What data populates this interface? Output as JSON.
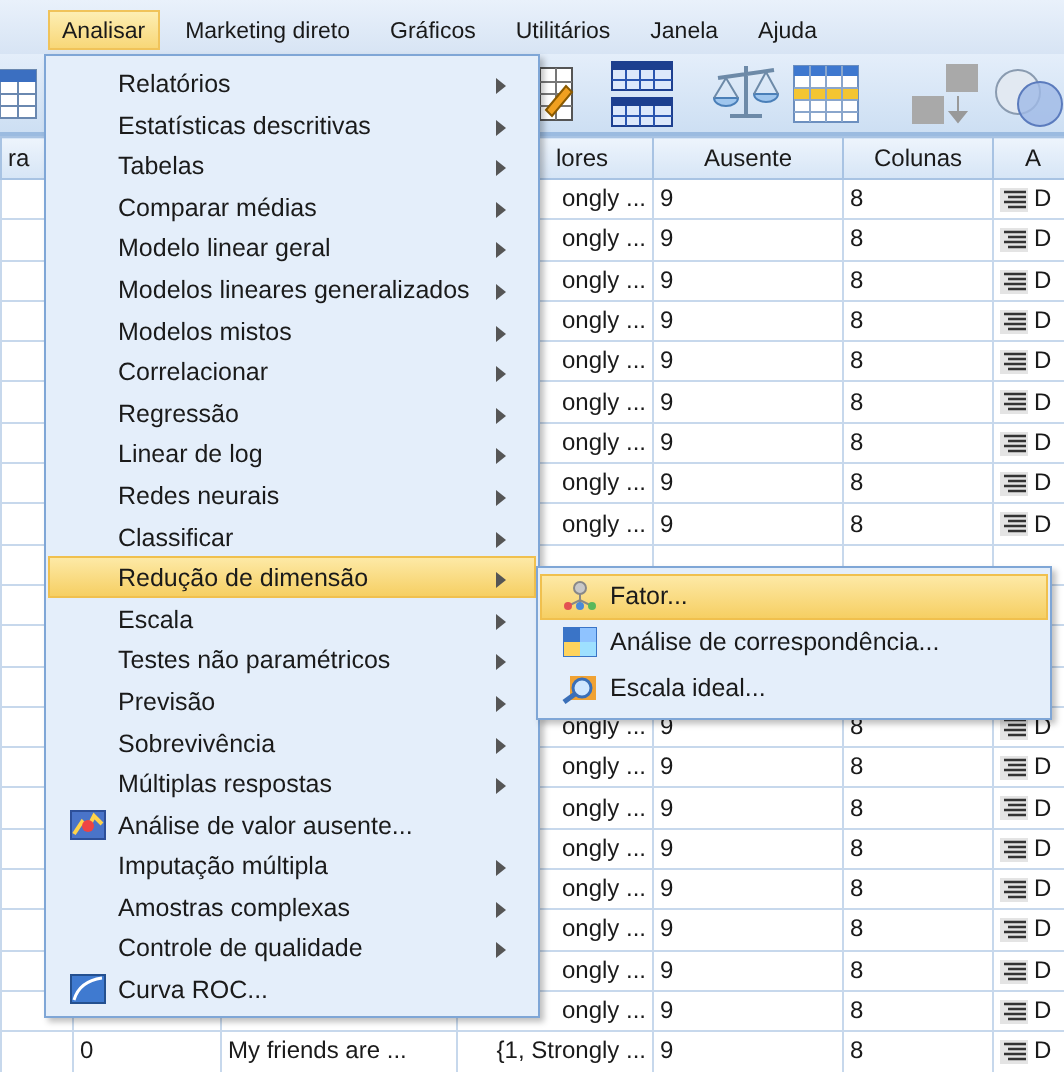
{
  "menu_bar": [
    {
      "label": "Analisar",
      "selected": true
    },
    {
      "label": "Marketing direto",
      "selected": false
    },
    {
      "label": "Gráficos",
      "selected": false
    },
    {
      "label": "Utilitários",
      "selected": false
    },
    {
      "label": "Janela",
      "selected": false
    },
    {
      "label": "Ajuda",
      "selected": false
    }
  ],
  "grid": {
    "columns": [
      {
        "header": "ra"
      },
      {},
      {},
      {
        "header": "lores"
      },
      {
        "header": "Ausente"
      },
      {
        "header": "Colunas"
      },
      {
        "header": "A"
      }
    ],
    "rows": [
      {
        "cells": [
          null,
          null,
          null,
          "ongly ...",
          "9",
          "8",
          "D"
        ]
      },
      {
        "cells": [
          null,
          null,
          null,
          "ongly ...",
          "9",
          "8",
          "D"
        ]
      },
      {
        "cells": [
          null,
          null,
          null,
          "ongly ...",
          "9",
          "8",
          "D"
        ]
      },
      {
        "cells": [
          null,
          null,
          null,
          "ongly ...",
          "9",
          "8",
          "D"
        ]
      },
      {
        "cells": [
          null,
          null,
          null,
          "ongly ...",
          "9",
          "8",
          "D"
        ]
      },
      {
        "cells": [
          null,
          null,
          null,
          "ongly ...",
          "9",
          "8",
          "D"
        ]
      },
      {
        "cells": [
          null,
          null,
          null,
          "ongly ...",
          "9",
          "8",
          "D"
        ]
      },
      {
        "cells": [
          null,
          null,
          null,
          "ongly ...",
          "9",
          "8",
          "D"
        ]
      },
      {
        "cells": [
          null,
          null,
          null,
          "ongly ...",
          "9",
          "8",
          "D"
        ]
      },
      {
        "cells": [
          null,
          null,
          null,
          null,
          null,
          null,
          null
        ]
      },
      {
        "cells": [
          null,
          null,
          null,
          null,
          null,
          null,
          null
        ]
      },
      {
        "cells": [
          null,
          null,
          null,
          null,
          null,
          null,
          null
        ]
      },
      {
        "cells": [
          null,
          null,
          null,
          null,
          null,
          null,
          null
        ]
      },
      {
        "cells": [
          null,
          null,
          null,
          "ongly ...",
          "9",
          "8",
          "D"
        ]
      },
      {
        "cells": [
          null,
          null,
          null,
          "ongly ...",
          "9",
          "8",
          "D"
        ]
      },
      {
        "cells": [
          null,
          null,
          null,
          "ongly ...",
          "9",
          "8",
          "D"
        ]
      },
      {
        "cells": [
          null,
          null,
          null,
          "ongly ...",
          "9",
          "8",
          "D"
        ]
      },
      {
        "cells": [
          null,
          null,
          null,
          "ongly ...",
          "9",
          "8",
          "D"
        ]
      },
      {
        "cells": [
          null,
          null,
          null,
          "ongly ...",
          "9",
          "8",
          "D"
        ]
      },
      {
        "cells": [
          null,
          null,
          null,
          "ongly ...",
          "9",
          "8",
          "D"
        ]
      },
      {
        "cells": [
          null,
          null,
          null,
          "ongly ...",
          "9",
          "8",
          "D"
        ]
      },
      {
        "cells": [
          null,
          "0",
          "My friends are ...",
          "{1, Strongly ...",
          "9",
          "8",
          "D"
        ]
      }
    ]
  },
  "menu": [
    {
      "label": "Relatórios",
      "kind": "submenu",
      "selected": false
    },
    {
      "label": "Estatísticas descritivas",
      "kind": "submenu",
      "selected": false
    },
    {
      "label": "Tabelas",
      "kind": "submenu",
      "selected": false
    },
    {
      "label": "Comparar médias",
      "kind": "submenu",
      "selected": false
    },
    {
      "label": "Modelo linear geral",
      "kind": "submenu",
      "selected": false
    },
    {
      "label": "Modelos lineares generalizados",
      "kind": "submenu",
      "selected": false
    },
    {
      "label": "Modelos mistos",
      "kind": "submenu",
      "selected": false
    },
    {
      "label": "Correlacionar",
      "kind": "submenu",
      "selected": false
    },
    {
      "label": "Regressão",
      "kind": "submenu",
      "selected": false
    },
    {
      "label": "Linear de log",
      "kind": "submenu",
      "selected": false
    },
    {
      "label": "Redes neurais",
      "kind": "submenu",
      "selected": false
    },
    {
      "label": "Classificar",
      "kind": "submenu",
      "selected": false
    },
    {
      "label": "Redução de dimensão",
      "kind": "submenu",
      "selected": true
    },
    {
      "label": "Escala",
      "kind": "submenu",
      "selected": false
    },
    {
      "label": "Testes não paramétricos",
      "kind": "submenu",
      "selected": false
    },
    {
      "label": "Previsão",
      "kind": "submenu",
      "selected": false
    },
    {
      "label": "Sobrevivência",
      "kind": "submenu",
      "selected": false
    },
    {
      "label": "Múltiplas respostas",
      "kind": "submenu",
      "selected": false
    },
    {
      "label": "Análise de valor ausente...",
      "kind": "command",
      "selected": false
    },
    {
      "label": "Imputação múltipla",
      "kind": "submenu",
      "selected": false
    },
    {
      "label": "Amostras complexas",
      "kind": "submenu",
      "selected": false
    },
    {
      "label": "Controle de qualidade",
      "kind": "submenu",
      "selected": false
    },
    {
      "label": "Curva ROC...",
      "kind": "command",
      "selected": false
    }
  ],
  "submenu": [
    {
      "label": "Fator...",
      "selected": true
    },
    {
      "label": "Análise de correspondência...",
      "selected": false
    },
    {
      "label": "Escala ideal...",
      "selected": false
    }
  ]
}
